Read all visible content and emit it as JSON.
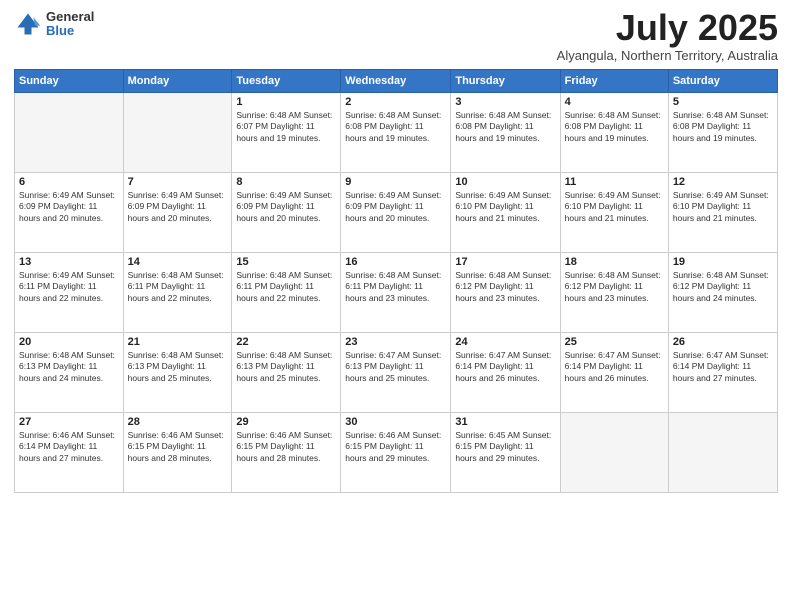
{
  "header": {
    "logo_general": "General",
    "logo_blue": "Blue",
    "month": "July 2025",
    "location": "Alyangula, Northern Territory, Australia"
  },
  "weekdays": [
    "Sunday",
    "Monday",
    "Tuesday",
    "Wednesday",
    "Thursday",
    "Friday",
    "Saturday"
  ],
  "weeks": [
    [
      {
        "day": "",
        "detail": ""
      },
      {
        "day": "",
        "detail": ""
      },
      {
        "day": "1",
        "detail": "Sunrise: 6:48 AM\nSunset: 6:07 PM\nDaylight: 11 hours and 19 minutes."
      },
      {
        "day": "2",
        "detail": "Sunrise: 6:48 AM\nSunset: 6:08 PM\nDaylight: 11 hours and 19 minutes."
      },
      {
        "day": "3",
        "detail": "Sunrise: 6:48 AM\nSunset: 6:08 PM\nDaylight: 11 hours and 19 minutes."
      },
      {
        "day": "4",
        "detail": "Sunrise: 6:48 AM\nSunset: 6:08 PM\nDaylight: 11 hours and 19 minutes."
      },
      {
        "day": "5",
        "detail": "Sunrise: 6:48 AM\nSunset: 6:08 PM\nDaylight: 11 hours and 19 minutes."
      }
    ],
    [
      {
        "day": "6",
        "detail": "Sunrise: 6:49 AM\nSunset: 6:09 PM\nDaylight: 11 hours and 20 minutes."
      },
      {
        "day": "7",
        "detail": "Sunrise: 6:49 AM\nSunset: 6:09 PM\nDaylight: 11 hours and 20 minutes."
      },
      {
        "day": "8",
        "detail": "Sunrise: 6:49 AM\nSunset: 6:09 PM\nDaylight: 11 hours and 20 minutes."
      },
      {
        "day": "9",
        "detail": "Sunrise: 6:49 AM\nSunset: 6:09 PM\nDaylight: 11 hours and 20 minutes."
      },
      {
        "day": "10",
        "detail": "Sunrise: 6:49 AM\nSunset: 6:10 PM\nDaylight: 11 hours and 21 minutes."
      },
      {
        "day": "11",
        "detail": "Sunrise: 6:49 AM\nSunset: 6:10 PM\nDaylight: 11 hours and 21 minutes."
      },
      {
        "day": "12",
        "detail": "Sunrise: 6:49 AM\nSunset: 6:10 PM\nDaylight: 11 hours and 21 minutes."
      }
    ],
    [
      {
        "day": "13",
        "detail": "Sunrise: 6:49 AM\nSunset: 6:11 PM\nDaylight: 11 hours and 22 minutes."
      },
      {
        "day": "14",
        "detail": "Sunrise: 6:48 AM\nSunset: 6:11 PM\nDaylight: 11 hours and 22 minutes."
      },
      {
        "day": "15",
        "detail": "Sunrise: 6:48 AM\nSunset: 6:11 PM\nDaylight: 11 hours and 22 minutes."
      },
      {
        "day": "16",
        "detail": "Sunrise: 6:48 AM\nSunset: 6:11 PM\nDaylight: 11 hours and 23 minutes."
      },
      {
        "day": "17",
        "detail": "Sunrise: 6:48 AM\nSunset: 6:12 PM\nDaylight: 11 hours and 23 minutes."
      },
      {
        "day": "18",
        "detail": "Sunrise: 6:48 AM\nSunset: 6:12 PM\nDaylight: 11 hours and 23 minutes."
      },
      {
        "day": "19",
        "detail": "Sunrise: 6:48 AM\nSunset: 6:12 PM\nDaylight: 11 hours and 24 minutes."
      }
    ],
    [
      {
        "day": "20",
        "detail": "Sunrise: 6:48 AM\nSunset: 6:13 PM\nDaylight: 11 hours and 24 minutes."
      },
      {
        "day": "21",
        "detail": "Sunrise: 6:48 AM\nSunset: 6:13 PM\nDaylight: 11 hours and 25 minutes."
      },
      {
        "day": "22",
        "detail": "Sunrise: 6:48 AM\nSunset: 6:13 PM\nDaylight: 11 hours and 25 minutes."
      },
      {
        "day": "23",
        "detail": "Sunrise: 6:47 AM\nSunset: 6:13 PM\nDaylight: 11 hours and 25 minutes."
      },
      {
        "day": "24",
        "detail": "Sunrise: 6:47 AM\nSunset: 6:14 PM\nDaylight: 11 hours and 26 minutes."
      },
      {
        "day": "25",
        "detail": "Sunrise: 6:47 AM\nSunset: 6:14 PM\nDaylight: 11 hours and 26 minutes."
      },
      {
        "day": "26",
        "detail": "Sunrise: 6:47 AM\nSunset: 6:14 PM\nDaylight: 11 hours and 27 minutes."
      }
    ],
    [
      {
        "day": "27",
        "detail": "Sunrise: 6:46 AM\nSunset: 6:14 PM\nDaylight: 11 hours and 27 minutes."
      },
      {
        "day": "28",
        "detail": "Sunrise: 6:46 AM\nSunset: 6:15 PM\nDaylight: 11 hours and 28 minutes."
      },
      {
        "day": "29",
        "detail": "Sunrise: 6:46 AM\nSunset: 6:15 PM\nDaylight: 11 hours and 28 minutes."
      },
      {
        "day": "30",
        "detail": "Sunrise: 6:46 AM\nSunset: 6:15 PM\nDaylight: 11 hours and 29 minutes."
      },
      {
        "day": "31",
        "detail": "Sunrise: 6:45 AM\nSunset: 6:15 PM\nDaylight: 11 hours and 29 minutes."
      },
      {
        "day": "",
        "detail": ""
      },
      {
        "day": "",
        "detail": ""
      }
    ]
  ]
}
